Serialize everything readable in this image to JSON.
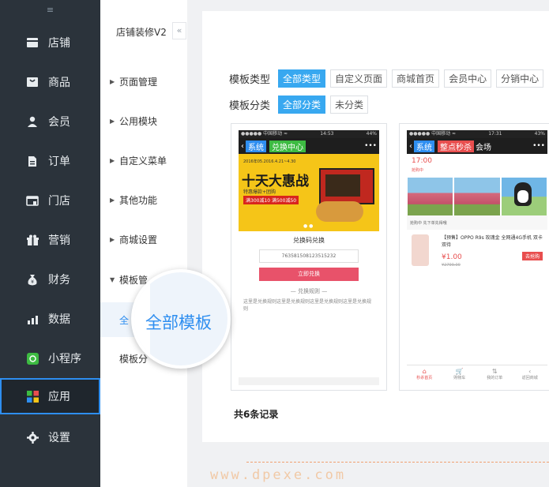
{
  "sidebar": {
    "collapse_icon": "≡",
    "items": [
      {
        "label": "店铺",
        "icon": "store-icon"
      },
      {
        "label": "商品",
        "icon": "goods-icon"
      },
      {
        "label": "会员",
        "icon": "member-icon"
      },
      {
        "label": "订单",
        "icon": "order-icon"
      },
      {
        "label": "门店",
        "icon": "shop-icon"
      },
      {
        "label": "营销",
        "icon": "gift-icon"
      },
      {
        "label": "财务",
        "icon": "money-bag-icon"
      },
      {
        "label": "数据",
        "icon": "chart-icon"
      },
      {
        "label": "小程序",
        "icon": "miniprogram-icon"
      },
      {
        "label": "应用",
        "icon": "apps-icon"
      },
      {
        "label": "设置",
        "icon": "gear-icon"
      }
    ],
    "active": "应用"
  },
  "subnav": {
    "title": "店铺装修V2",
    "collapse_arrow": "«",
    "items": [
      "页面管理",
      "公用模块",
      "自定义菜单",
      "其他功能",
      "商城设置",
      "模板管理"
    ],
    "children": [
      "全部模板",
      "模板分类"
    ],
    "partial_children": {
      "active": "全",
      "second": "模板分"
    },
    "partial_parent": "模板管"
  },
  "magnifier": {
    "text": "全部模板"
  },
  "filters": {
    "type_label": "模板类型",
    "types": [
      "全部类型",
      "自定义页面",
      "商城首页",
      "会员中心",
      "分销中心"
    ],
    "category_label": "模板分类",
    "categories": [
      "全部分类",
      "未分类"
    ]
  },
  "card1": {
    "status_left": "●●●●● 中国移动 ≈",
    "status_time": "14:53",
    "status_right": "44%",
    "back": "‹",
    "sys_tag": "系统",
    "title_tag": "兑换中心",
    "more": "•••",
    "banner_date": "2016年05.2016.4.21~4.30",
    "banner_big": "十天大惠战",
    "banner_sub": "特惠爆款+团购",
    "banner_red": "满300减10 满500减50",
    "pager": "● ●",
    "redeem_title": "兑换码兑换",
    "code": "7635815081235152​32",
    "btn": "立即兑换",
    "rule": "— 兑换规则 —",
    "rule_text": "这里是兑换规则这里是兑换规则这里是兑换规则这里是兑换规则"
  },
  "card2": {
    "status_left": "●●●●● 中国移动 ≈",
    "status_time": "17:31",
    "status_right": "43%",
    "back": "‹",
    "sys_tag": "系统",
    "title_tag": "整点秒杀",
    "title_suffix": "会场",
    "more": "•••",
    "time": "17:00",
    "time_label": "抢购中",
    "group_row": "抢购中 先下单先得哦",
    "product_name": "【预售】OPPO R9s 玫瑰金 全网通4G手机 双卡双待",
    "price": "¥1.00",
    "old_price": "¥2799.00",
    "go_btn": "去抢购",
    "tabs": [
      {
        "icon": "⌂",
        "label": "秒杀首页"
      },
      {
        "icon": "🛒",
        "label": "购物车"
      },
      {
        "icon": "⇅",
        "label": "我的订单"
      },
      {
        "icon": "‹",
        "label": "返回商城"
      }
    ]
  },
  "records": "共6条记录",
  "watermark": "www.dpexe.com",
  "colors": {
    "sidebar": "#2b333b",
    "accent": "#2e8ef0",
    "chip_on": "#38a8f0",
    "red": "#e84e4e"
  }
}
